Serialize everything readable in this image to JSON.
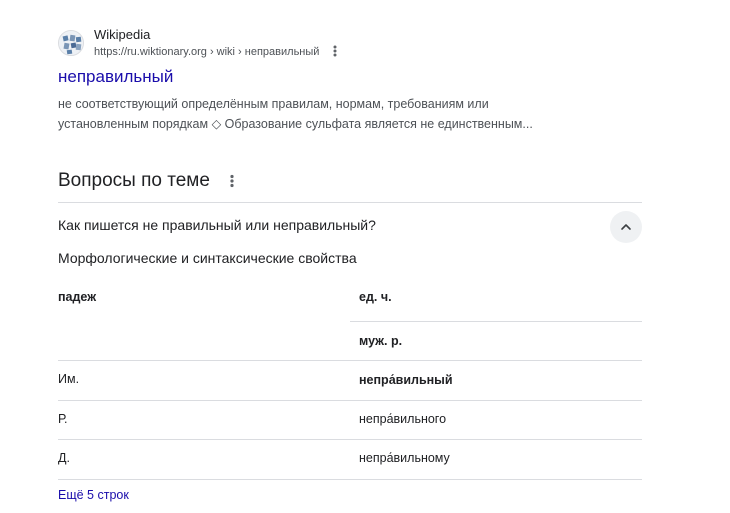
{
  "result": {
    "site_name": "Wikipedia",
    "url": "https://ru.wiktionary.org › wiki › неправильный",
    "title": "неправильный",
    "snippet": "не соответствующий определённым правилам, нормам, требованиям или установленным порядкам ◇ Образование сульфата является не единственным...",
    "icons": {
      "favicon": "wiktionary-logo",
      "menu": "more-vert-icon"
    }
  },
  "questions": {
    "heading": "Вопросы по теме",
    "menu_icon": "more-vert-icon",
    "question": "Как пишется не правильный или неправильный?",
    "expanded": true,
    "collapse_icon": "chevron-up-icon",
    "answer_heading": "Морфологические и синтаксические свойства",
    "table": {
      "col_case": "падеж",
      "col_number": "ед. ч.",
      "col_gender": "муж. р.",
      "rows": [
        {
          "case": "Им.",
          "form": "непра́вильный",
          "bold": true
        },
        {
          "case": "Р.",
          "form": "непра́вильного",
          "bold": false
        },
        {
          "case": "Д.",
          "form": "непра́вильному",
          "bold": false
        }
      ]
    },
    "more_link": "Ещё 5 строк"
  },
  "colors": {
    "link": "#1a0dab",
    "text": "#202124",
    "muted": "#4d5156",
    "divider": "#dadce0"
  }
}
